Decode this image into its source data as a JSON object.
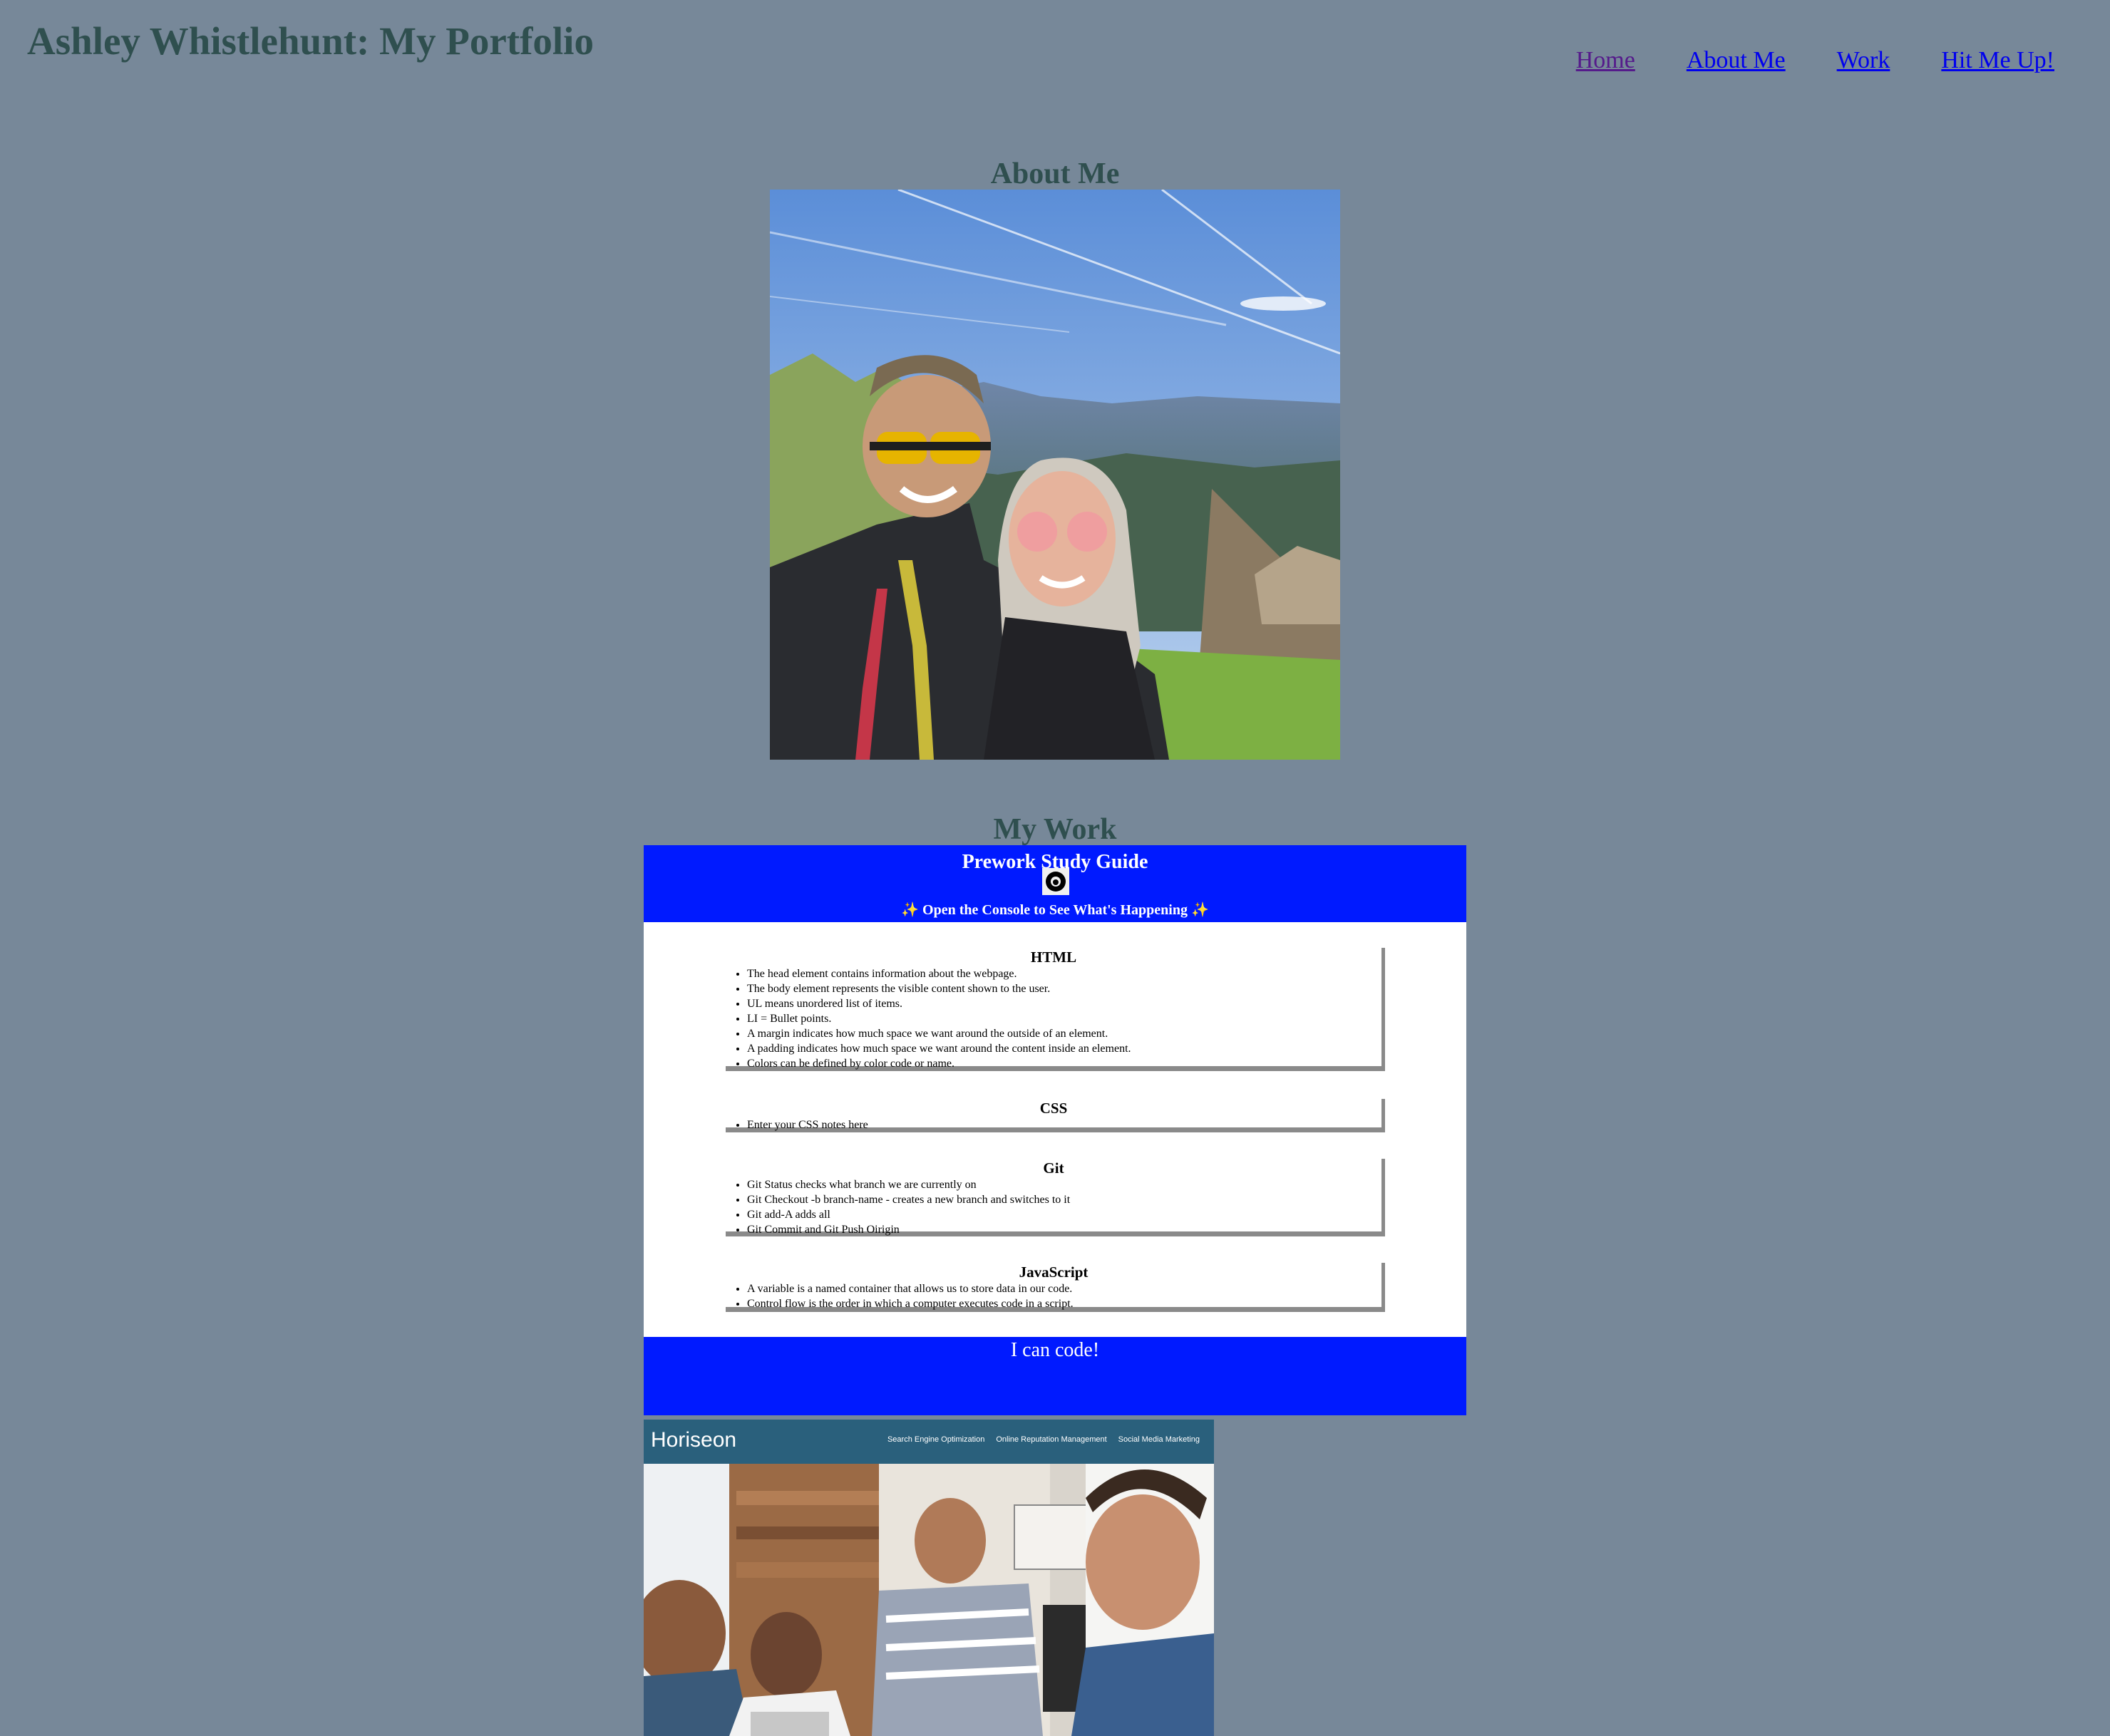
{
  "header": {
    "title": "Ashley Whistlehunt: My Portfolio",
    "nav": [
      {
        "label": "Home"
      },
      {
        "label": "About Me"
      },
      {
        "label": "Work"
      },
      {
        "label": "Hit Me Up!"
      }
    ]
  },
  "about": {
    "heading": "About Me",
    "photo_icon": "couple-selfie-photo"
  },
  "work": {
    "heading": "My Work",
    "prework": {
      "title": "Prework Study Guide",
      "subtitle": "✨ Open the Console to See What's Happening ✨",
      "sections": [
        {
          "heading": "HTML",
          "items": [
            "The head element contains information about the webpage.",
            "The body element represents the visible content shown to the user.",
            "UL means unordered list of items.",
            "LI = Bullet points.",
            "A margin indicates how much space we want around the outside of an element.",
            "A padding indicates how much space we want around the content inside an element.",
            "Colors can be defined by color code or name."
          ]
        },
        {
          "heading": "CSS",
          "items": [
            "Enter your CSS notes here"
          ]
        },
        {
          "heading": "Git",
          "items": [
            "Git Status checks what branch we are currently on",
            "Git Checkout -b branch-name - creates a new branch and switches to it",
            "Git add-A adds all",
            "Git Commit and Git Push Oirigin"
          ]
        },
        {
          "heading": "JavaScript",
          "items": [
            "A variable is a named container that allows us to store data in our code.",
            "Control flow is the order in which a computer executes code in a script."
          ]
        }
      ],
      "footer": "I can code!"
    },
    "horiseon": {
      "logo": "Horiseon",
      "nav": [
        "Search Engine Optimization",
        "Online Reputation Management",
        "Social Media Marketing"
      ]
    }
  },
  "colors": {
    "background": "#778899",
    "heading": "#2f4f4f",
    "link": "#0000ee",
    "visited_link": "#551a8b",
    "prework_blue": "#001aff",
    "horiseon_header": "#2a607c"
  }
}
